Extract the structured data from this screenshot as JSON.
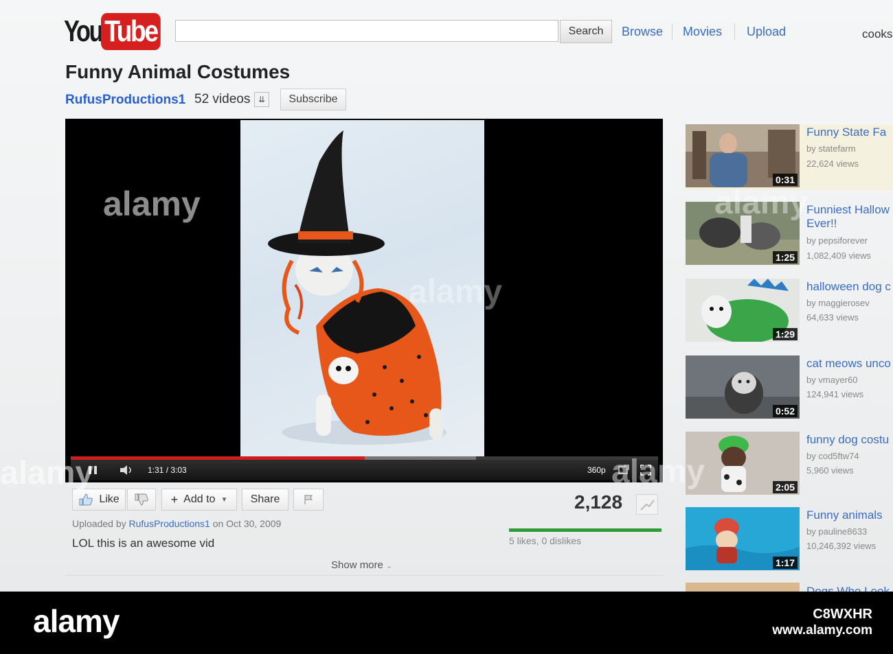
{
  "header": {
    "logo_you": "You",
    "logo_tube": "Tube",
    "search_value": "",
    "search_button": "Search",
    "nav": [
      "Browse",
      "Movies",
      "Upload"
    ],
    "user": "cooks"
  },
  "video": {
    "title": "Funny Animal Costumes",
    "channel": "RufusProductions1",
    "video_count": "52 videos",
    "subscribe": "Subscribe",
    "time": "1:31 / 3:03",
    "progress_played": 0.5,
    "progress_loaded": 0.69,
    "quality": "360p"
  },
  "actions": {
    "like": "Like",
    "add_to": "Add to",
    "share": "Share",
    "views": "2,128",
    "like_stats": "5 likes, 0 dislikes",
    "like_ratio": 1.0
  },
  "info": {
    "uploaded_prefix": "Uploaded by",
    "uploader": "RufusProductions1",
    "uploaded_suffix": "on Oct 30, 2009",
    "description": "LOL this is an awesome vid",
    "show_more": "Show more"
  },
  "related": [
    {
      "title": "Funny State Fa",
      "by": "by statefarm",
      "views": "22,624 views",
      "duration": "0:31"
    },
    {
      "title": "Funniest Hallow",
      "title2": "Ever!!",
      "by": "by pepsiforever",
      "views": "1,082,409 views",
      "duration": "1:25"
    },
    {
      "title": "halloween dog c",
      "by": "by maggierosev",
      "views": "64,633 views",
      "duration": "1:29"
    },
    {
      "title": "cat meows unco",
      "by": "by vmayer60",
      "views": "124,941 views",
      "duration": "0:52"
    },
    {
      "title": "funny dog costu",
      "by": "by cod5ftw74",
      "views": "5,960 views",
      "duration": "2:05"
    },
    {
      "title": "Funny animals",
      "by": "by pauline8633",
      "views": "10,246,392 views",
      "duration": "1:17"
    },
    {
      "title": "Dogs Who Look"
    }
  ],
  "stock": {
    "logo": "alamy",
    "id": "C8WXHR",
    "url": "www.alamy.com",
    "watermark": "alamy"
  },
  "colors": {
    "link": "#3b6cc5",
    "brand_red": "#d61f1f",
    "progress": "#d11d1d",
    "like_bar": "#2f9a3a"
  }
}
